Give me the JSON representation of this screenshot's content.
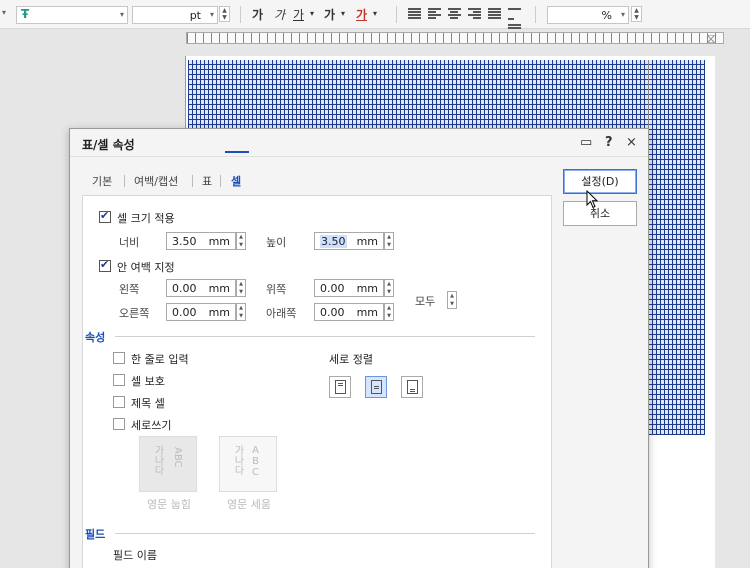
{
  "toolbar": {
    "font_size_unit": "pt",
    "zoom_unit": "%",
    "bold_glyph": "가",
    "italic_glyph": "가",
    "underline_glyph": "가",
    "strike_glyph": "가",
    "color_glyph": "가",
    "style_glyph": "Ŧ",
    "arrow": "▾",
    "colors": {
      "font_color": "#c0392b",
      "highlight": "#1f9c8a"
    }
  },
  "dialog": {
    "title": "표/셀 속성",
    "title_icons": {
      "memo": "▭",
      "help": "?",
      "close": "×"
    },
    "tabs": [
      {
        "label": "기본"
      },
      {
        "label": "여백/캡션"
      },
      {
        "label": "표"
      },
      {
        "label": "셀"
      }
    ],
    "ok_button": "설정(D)",
    "cancel_button": "취소",
    "cell_size": {
      "checkbox_label": "셀 크기 적용",
      "width_label": "너비",
      "width_value": "3.50",
      "height_label": "높이",
      "height_value": "3.50",
      "unit": "mm"
    },
    "inner_margin": {
      "checkbox_label": "안 여백 지정",
      "left_label": "왼쪽",
      "left_value": "0.00",
      "top_label": "위쪽",
      "top_value": "0.00",
      "right_label": "오른쪽",
      "right_value": "0.00",
      "bottom_label": "아래쪽",
      "bottom_value": "0.00",
      "all_label": "모두",
      "unit": "mm"
    },
    "properties": {
      "section_label": "속성",
      "single_line_label": "한 줄로 입력",
      "protect_label": "셀 보호",
      "title_cell_label": "제목 셀",
      "vertical_writing_label": "세로쓰기",
      "valign_label": "세로 정렬",
      "orient_lay_label": "영문 눕힘",
      "orient_stand_label": "영문 세움",
      "orient_ko": "가나다",
      "orient_en": "ABC"
    },
    "field": {
      "section_label": "필드",
      "name_label": "필드 이름"
    }
  }
}
